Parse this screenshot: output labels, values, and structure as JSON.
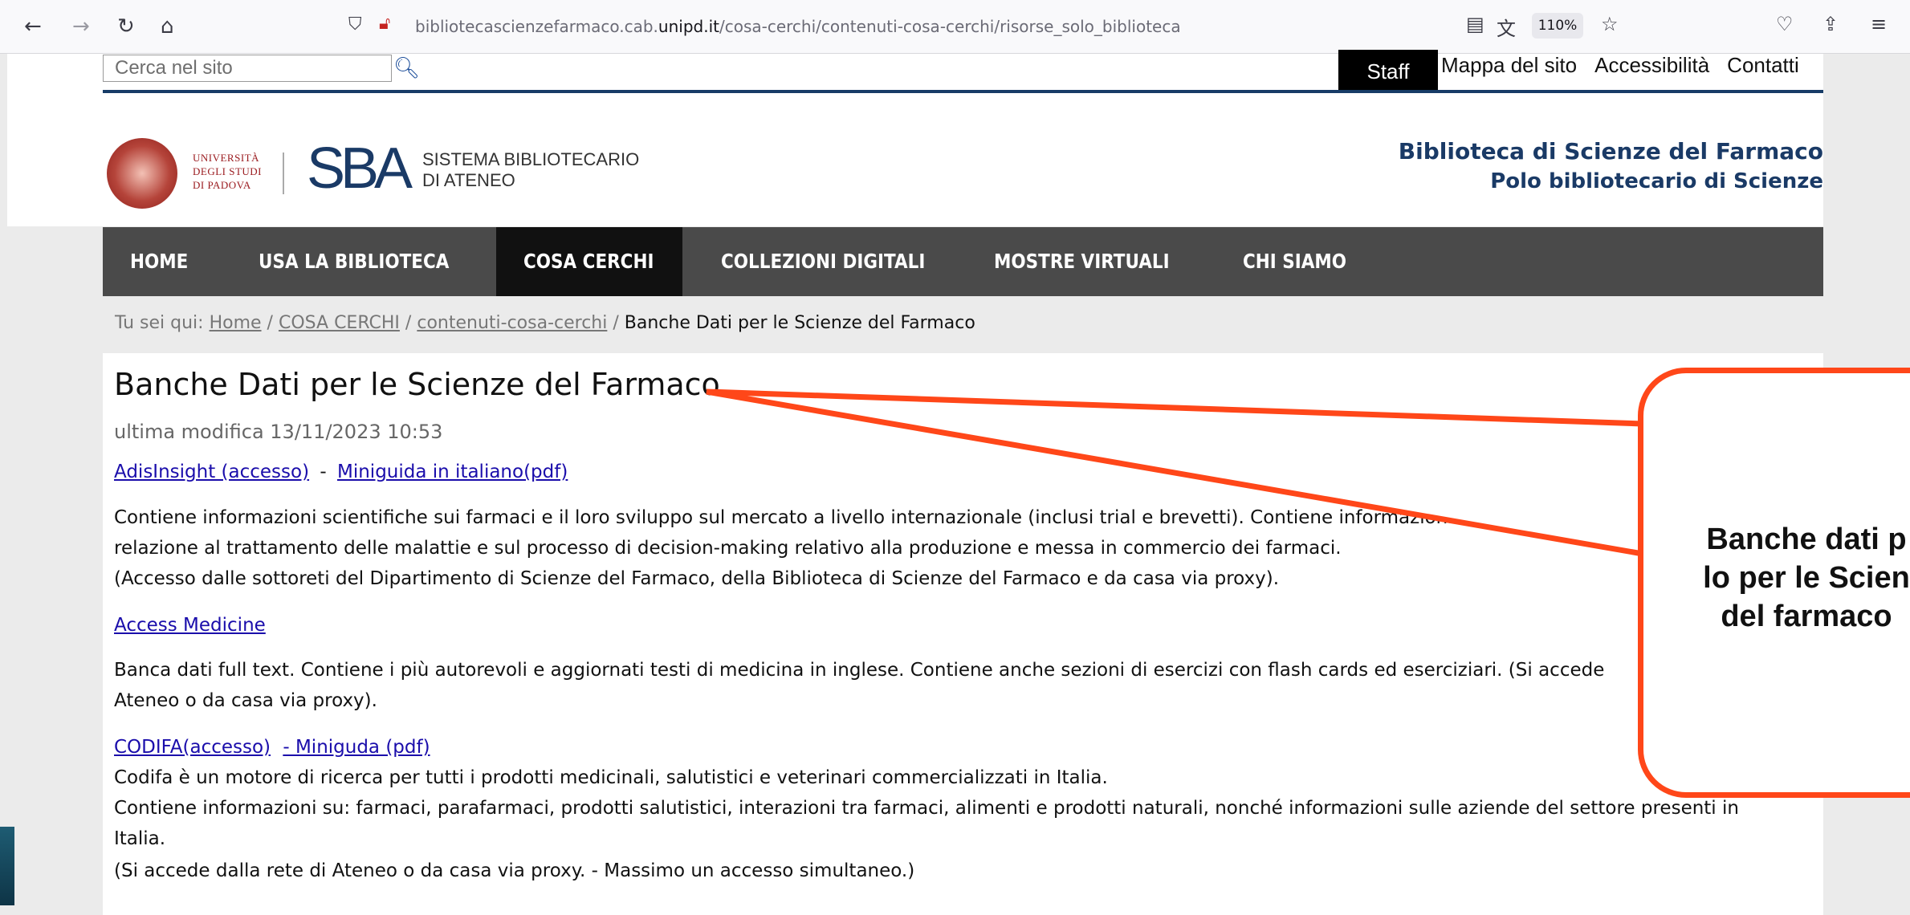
{
  "browser": {
    "url_prefix": "bibliotecascienzefarmaco.cab.",
    "url_domain": "unipd.it",
    "url_path": "/cosa-cerchi/contenuti-cosa-cerchi/risorse_solo_biblioteca",
    "zoom": "110%"
  },
  "search": {
    "placeholder": "Cerca nel sito"
  },
  "toplinks": {
    "staff": "Staff",
    "sitemap": "Mappa del sito",
    "accessibility": "Accessibilità",
    "contacts": "Contatti"
  },
  "header": {
    "uni_line1": "UNIVERSITÀ",
    "uni_line2": "DEGLI STUDI",
    "uni_line3": "DI PADOVA",
    "sba": "SBA",
    "sba_line1": "SISTEMA BIBLIOTECARIO",
    "sba_line2": "DI ATENEO",
    "library_name": "Biblioteca di Scienze del Farmaco",
    "polo": "Polo bibliotecario di Scienze"
  },
  "nav": [
    "HOME",
    "USA LA BIBLIOTECA",
    "COSA CERCHI",
    "COLLEZIONI DIGITALI",
    "MOSTRE VIRTUALI",
    "CHI SIAMO"
  ],
  "breadcrumb": {
    "prefix": "Tu sei qui:",
    "home": "Home",
    "sep": "/",
    "cosa": "COSA CERCHI",
    "contenuti": "contenuti-cosa-cerchi",
    "current": "Banche Dati per le Scienze del Farmaco"
  },
  "page": {
    "title": "Banche Dati per le Scienze del Farmaco",
    "modified": "ultima modifica 13/11/2023 10:53",
    "adis_link": "AdisInsight (accesso)",
    "dash": "-",
    "adis_guide": "Miniguida in italiano(pdf)",
    "adis_p1": "Contiene informazioni scientifiche sui farmaci e il loro sviluppo sul mercato a livello internazionale (inclusi trial e brevetti). Contiene informazioni",
    "adis_p2": "relazione al  trattamento delle malattie e  sul processo di decision-making relativo alla produzione e messa in commercio dei farmaci.",
    "adis_p3": "(Accesso dalle sottoreti del Dipartimento di Scienze del Farmaco,  della Biblioteca di Scienze del Farmaco e da casa via proxy).",
    "access_link": "Access Medicine",
    "access_p1": "Banca dati full text. Contiene i più autorevoli e aggiornati testi di  medicina in inglese. Contiene anche sezioni di esercizi con flash cards ed eserciziari. (Si accede",
    "access_p2": "Ateneo o da casa via proxy).",
    "codifa_link": "CODIFA(accesso)",
    "codifa_guide": "- Miniguda (pdf)",
    "codifa_p1": "Codifa è un motore di ricerca per tutti i prodotti medicinali, salutistici e veterinari commercializzati in Italia.",
    "codifa_p2": "Contiene informazioni su: farmaci, parafarmaci, prodotti salutistici, interazioni tra farmaci, alimenti e prodotti naturali, nonché informazioni sulle aziende del settore presenti in",
    "codifa_p3": "Italia.",
    "codifa_p4": "(Si accede dalla rete di Ateneo o da casa via proxy. - Massimo un accesso simultaneo.)"
  },
  "callout": {
    "line1": "Banche dati p",
    "line2": "lo per le Scien",
    "line3": "del farmaco"
  },
  "colors": {
    "nav_bg": "#4a4a4a",
    "nav_active": "#111111",
    "brand_blue": "#1a3a66",
    "callout_red": "#ff4719",
    "link": "#1a0dab"
  }
}
